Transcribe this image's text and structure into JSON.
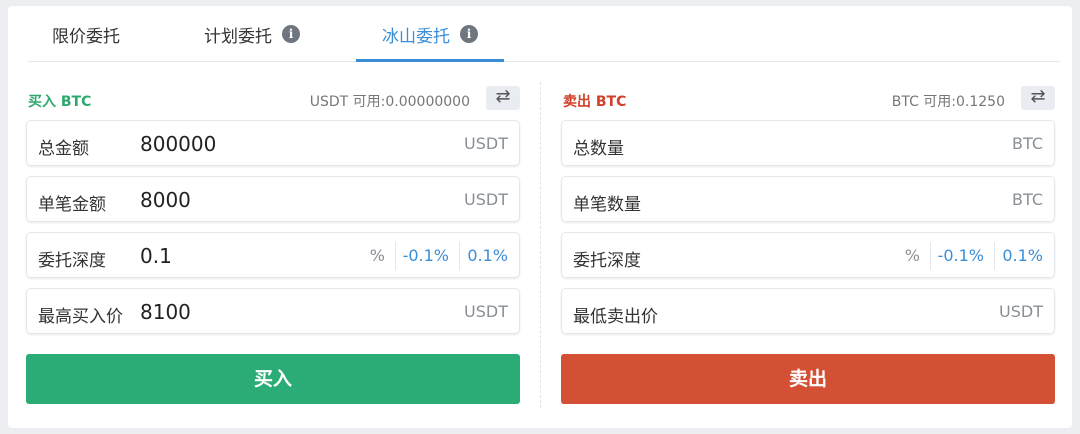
{
  "tabs": [
    {
      "label": "限价委托",
      "active": false
    },
    {
      "label": "计划委托",
      "active": false,
      "has_info": true
    },
    {
      "label": "冰山委托",
      "active": true,
      "has_info": true
    }
  ],
  "info_glyph": "i",
  "swap_glyph": "⇄",
  "buy": {
    "title": "买入 BTC",
    "available": "USDT 可用:0.00000000",
    "fields": {
      "total": {
        "label": "总金额",
        "value": "800000",
        "unit": "USDT"
      },
      "single": {
        "label": "单笔金额",
        "value": "8000",
        "unit": "USDT"
      },
      "depth": {
        "label": "委托深度",
        "value": "0.1",
        "unit": "%",
        "minus": "-0.1%",
        "plus": "0.1%"
      },
      "price": {
        "label": "最高买入价",
        "value": "8100",
        "unit": "USDT"
      }
    },
    "button": "买入"
  },
  "sell": {
    "title": "卖出 BTC",
    "available": "BTC 可用:0.1250",
    "fields": {
      "total": {
        "label": "总数量",
        "value": "",
        "unit": "BTC"
      },
      "single": {
        "label": "单笔数量",
        "value": "",
        "unit": "BTC"
      },
      "depth": {
        "label": "委托深度",
        "value": "",
        "unit": "%",
        "minus": "-0.1%",
        "plus": "0.1%"
      },
      "price": {
        "label": "最低卖出价",
        "value": "",
        "unit": "USDT"
      }
    },
    "button": "卖出"
  },
  "colors": {
    "accent": "#3a8ed6",
    "buy": "#2bab75",
    "sell": "#d45034"
  }
}
